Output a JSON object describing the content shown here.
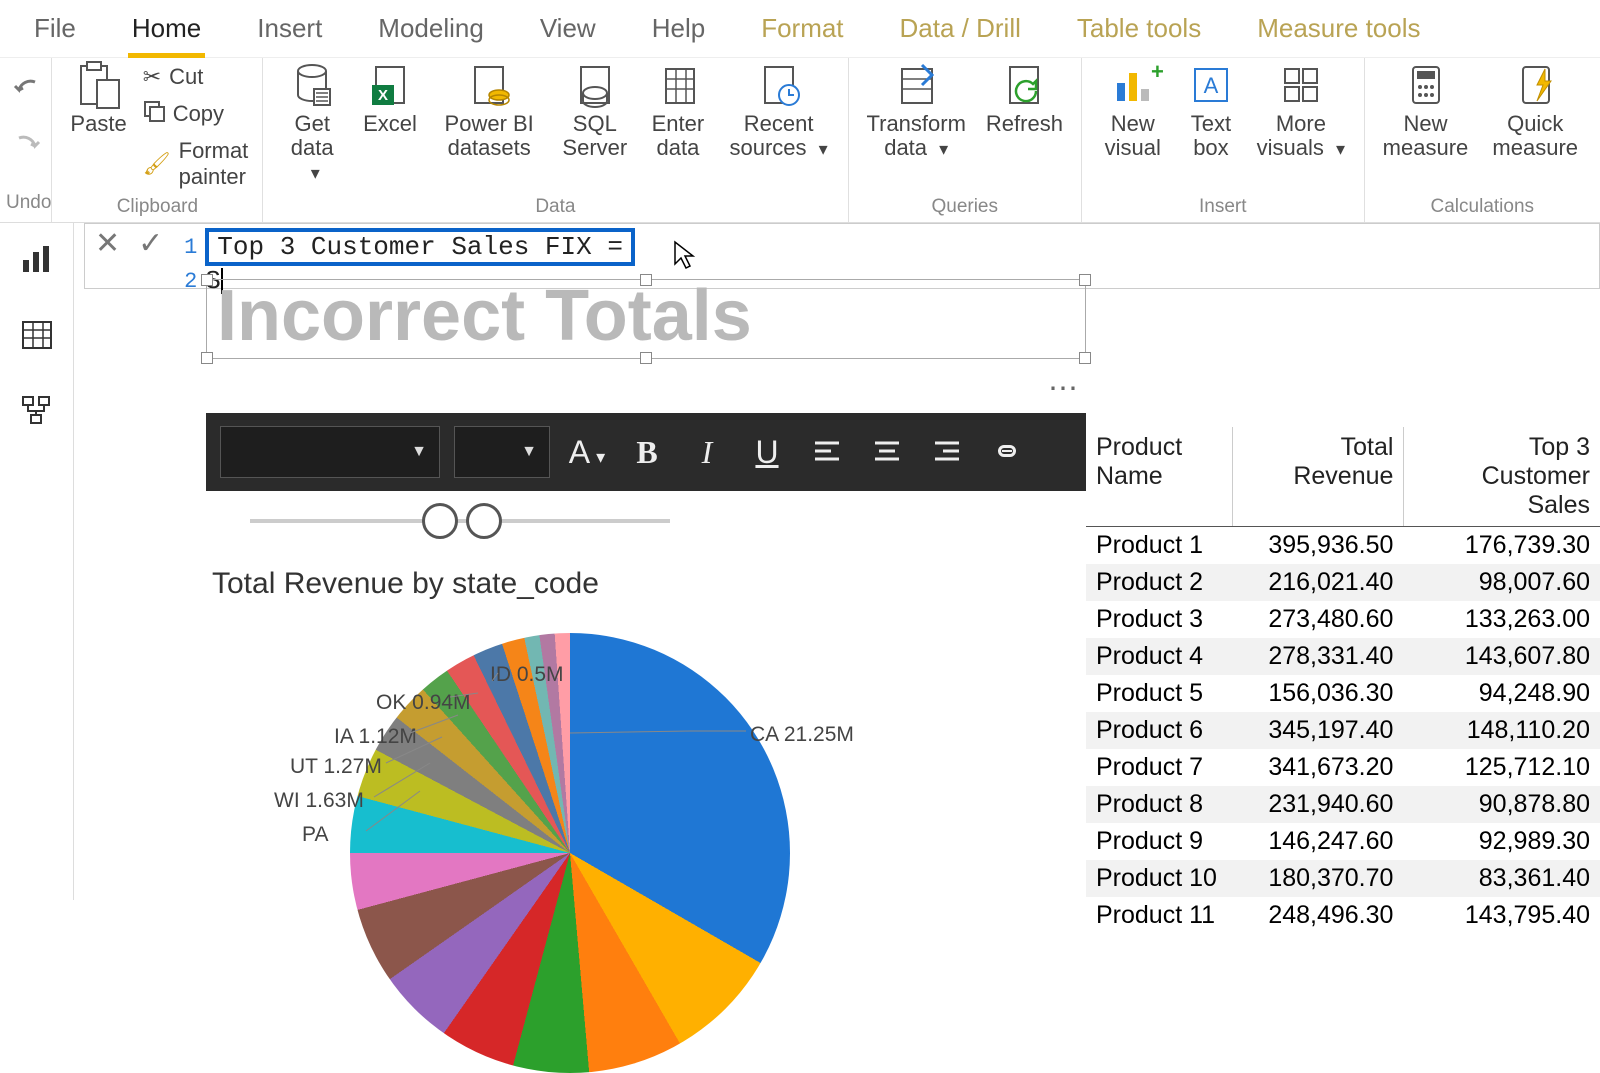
{
  "menu": {
    "items": [
      "File",
      "Home",
      "Insert",
      "Modeling",
      "View",
      "Help",
      "Format",
      "Data / Drill",
      "Table tools",
      "Measure tools"
    ],
    "active_index": 1,
    "contextual_start": 6
  },
  "ribbon": {
    "undo_label": "Undo",
    "clipboard": {
      "paste": "Paste",
      "cut": "Cut",
      "copy": "Copy",
      "format_painter": "Format painter",
      "group": "Clipboard"
    },
    "data": {
      "get": "Get data",
      "excel": "Excel",
      "pbi": "Power BI datasets",
      "sql": "SQL Server",
      "enter": "Enter data",
      "recent": "Recent sources",
      "group": "Data"
    },
    "queries": {
      "transform": "Transform data",
      "refresh": "Refresh",
      "group": "Queries"
    },
    "insert": {
      "newvis": "New visual",
      "textbox": "Text box",
      "more": "More visuals",
      "group": "Insert"
    },
    "calc": {
      "newmeasure": "New measure",
      "quick": "Quick measure",
      "group": "Calculations"
    }
  },
  "formula": {
    "line1": "Top 3 Customer Sales FIX =",
    "line2_prefix": "S"
  },
  "title_text": "Incorrect Totals",
  "floatbar": {
    "font_color_glyph": "A",
    "bold": "B",
    "italic": "I",
    "underline": "U"
  },
  "chart": {
    "title": "Total Revenue by state_code"
  },
  "chart_data": {
    "type": "pie",
    "title": "Total Revenue by state_code",
    "unit": "M",
    "slices": [
      {
        "label": "CA",
        "value": 21.25
      },
      {
        "label": "WI",
        "value": 1.63
      },
      {
        "label": "UT",
        "value": 1.27
      },
      {
        "label": "IA",
        "value": 1.12
      },
      {
        "label": "OK",
        "value": 0.94
      },
      {
        "label": "ID",
        "value": 0.5
      },
      {
        "label": "PA",
        "value": null
      }
    ],
    "visible_labels": [
      {
        "text": "CA 21.25M"
      },
      {
        "text": "ID 0.5M"
      },
      {
        "text": "OK 0.94M"
      },
      {
        "text": "IA 1.12M"
      },
      {
        "text": "UT 1.27M"
      },
      {
        "text": "WI 1.63M"
      },
      {
        "text": "PA"
      }
    ]
  },
  "table": {
    "columns": [
      "Product Name",
      "Total Revenue",
      "Top 3 Customer Sales"
    ],
    "rows": [
      {
        "name": "Product 1",
        "rev": "395,936.50",
        "top3": "176,739.30"
      },
      {
        "name": "Product 2",
        "rev": "216,021.40",
        "top3": "98,007.60"
      },
      {
        "name": "Product 3",
        "rev": "273,480.60",
        "top3": "133,263.00"
      },
      {
        "name": "Product 4",
        "rev": "278,331.40",
        "top3": "143,607.80"
      },
      {
        "name": "Product 5",
        "rev": "156,036.30",
        "top3": "94,248.90"
      },
      {
        "name": "Product 6",
        "rev": "345,197.40",
        "top3": "148,110.20"
      },
      {
        "name": "Product 7",
        "rev": "341,673.20",
        "top3": "125,712.10"
      },
      {
        "name": "Product 8",
        "rev": "231,940.60",
        "top3": "90,878.80"
      },
      {
        "name": "Product 9",
        "rev": "146,247.60",
        "top3": "92,989.30"
      },
      {
        "name": "Product 10",
        "rev": "180,370.70",
        "top3": "83,361.40"
      },
      {
        "name": "Product 11",
        "rev": "248,496.30",
        "top3": "143,795.40"
      }
    ]
  }
}
